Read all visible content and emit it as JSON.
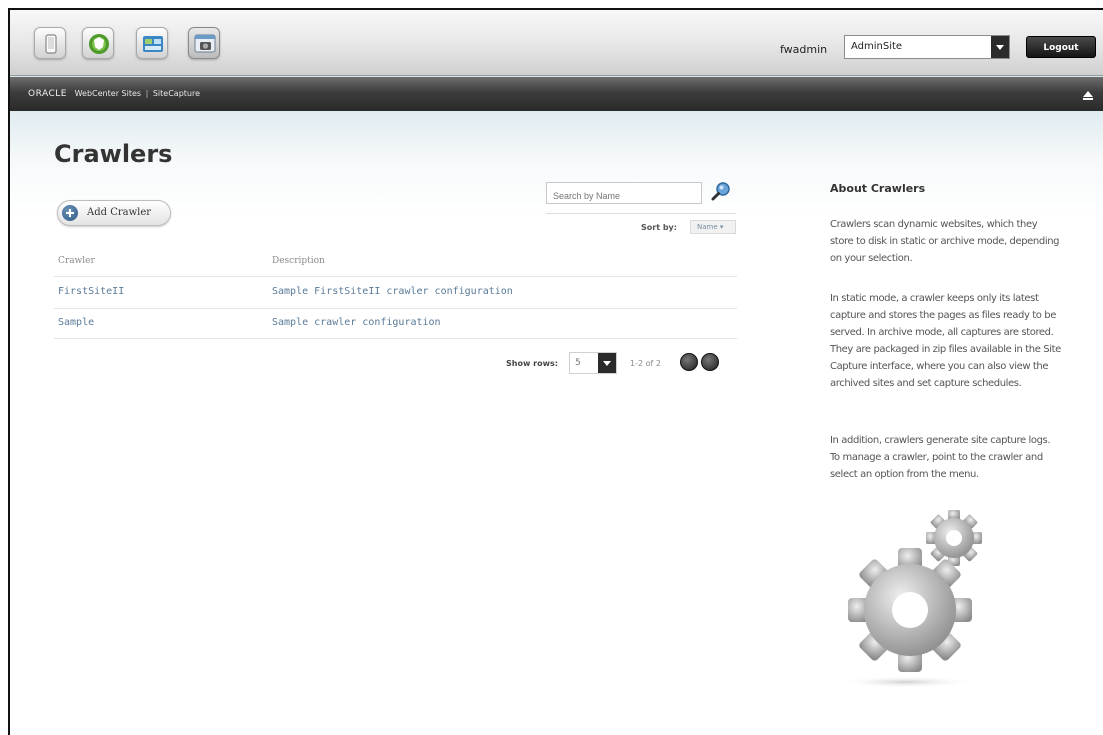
{
  "header": {
    "username": "fwadmin",
    "site_selector": {
      "selected": "AdminSite"
    },
    "logout_label": "Logout",
    "app_buttons": [
      {
        "name": "contributor-app",
        "icon": "mobile-device-icon"
      },
      {
        "name": "admin-app",
        "icon": "green-shield-icon"
      },
      {
        "name": "dashboard-app",
        "icon": "dashboard-window-icon"
      },
      {
        "name": "sitecapture-app",
        "icon": "camera-window-icon",
        "active": true
      }
    ]
  },
  "brand": {
    "oracle": "ORACLE",
    "product": "WebCenter Sites",
    "separator": "|",
    "module": "SiteCapture"
  },
  "main": {
    "title": "Crawlers",
    "add_button_label": "Add Crawler",
    "search": {
      "placeholder": "Search by Name"
    },
    "sort": {
      "label": "Sort by:",
      "selected": "Name"
    },
    "table": {
      "columns": [
        "Crawler",
        "Description"
      ],
      "rows": [
        {
          "crawler": "FirstSiteII",
          "description": "Sample FirstSiteII crawler configuration"
        },
        {
          "crawler": "Sample",
          "description": "Sample crawler configuration"
        }
      ]
    },
    "pager": {
      "show_rows_label": "Show rows:",
      "rows_per_page": "5",
      "range_text": "1-2 of 2"
    }
  },
  "about": {
    "title": "About Crawlers",
    "paragraphs": [
      "Crawlers scan dynamic websites, which they store to disk in static or archive mode, depending on your selection.",
      "In static mode, a crawler keeps only its latest capture and stores the pages as files ready to be served. In archive mode, all captures are stored. They are packaged in zip files available in the Site Capture interface, where you can also view the archived sites and set capture schedules.",
      "In addition, crawlers generate site capture logs. To manage a crawler, point to the crawler and select an option from the menu."
    ]
  },
  "colors": {
    "link_blue": "#5a7a98",
    "header_dark": "#2a2a2a",
    "accent_blue": "#2d5885"
  }
}
